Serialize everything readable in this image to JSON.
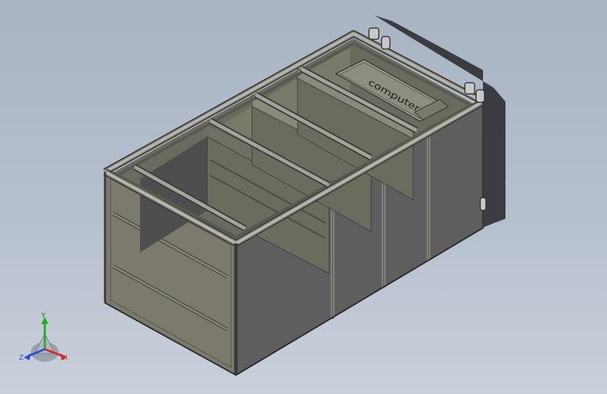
{
  "viewport": {
    "background_top": "#a9b4c3",
    "background_bottom": "#c9d0da"
  },
  "model": {
    "label_text": "computer",
    "frame_color": "#6b6d60",
    "panel_front": "#7b7a6c",
    "panel_side": "#5a5a5a",
    "interior": "#6e6e62",
    "shadow": "#2e2f33"
  },
  "triad": {
    "y_label": "Y",
    "x_label": "X",
    "z_label": "Z",
    "y_color": "#22aa22",
    "x_color": "#d62b2b",
    "z_color": "#2d4fd1"
  }
}
